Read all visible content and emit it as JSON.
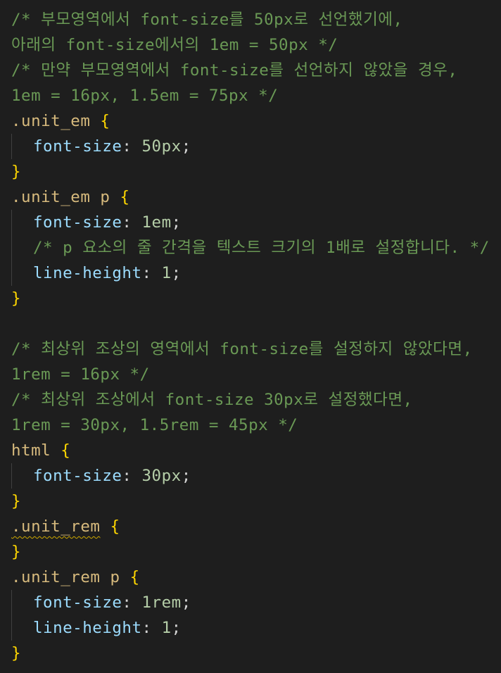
{
  "editor": {
    "lines": [
      {
        "segments": [
          {
            "t": "c",
            "v": "/* 부모영역에서 font-size를 50px로 선언했기에,"
          }
        ]
      },
      {
        "segments": [
          {
            "t": "c",
            "v": "아래의 font-size에서의 1em = 50px */"
          }
        ]
      },
      {
        "segments": [
          {
            "t": "c",
            "v": "/* 만약 부모영역에서 font-size를 선언하지 않았을 경우,"
          }
        ]
      },
      {
        "segments": [
          {
            "t": "c",
            "v": "1em = 16px, 1.5em = 75px */"
          }
        ]
      },
      {
        "segments": [
          {
            "t": "sel",
            "v": ".unit_em"
          },
          {
            "t": "plain",
            "v": " "
          },
          {
            "t": "br",
            "v": "{"
          }
        ]
      },
      {
        "indent": true,
        "segments": [
          {
            "t": "prop",
            "v": "font-size"
          },
          {
            "t": "plain",
            "v": ": "
          },
          {
            "t": "num",
            "v": "50px"
          },
          {
            "t": "plain",
            "v": ";"
          }
        ]
      },
      {
        "segments": [
          {
            "t": "br",
            "v": "}"
          }
        ]
      },
      {
        "segments": [
          {
            "t": "sel",
            "v": ".unit_em p"
          },
          {
            "t": "plain",
            "v": " "
          },
          {
            "t": "br",
            "v": "{"
          }
        ]
      },
      {
        "indent": true,
        "segments": [
          {
            "t": "prop",
            "v": "font-size"
          },
          {
            "t": "plain",
            "v": ": "
          },
          {
            "t": "num",
            "v": "1em"
          },
          {
            "t": "plain",
            "v": ";"
          }
        ]
      },
      {
        "indent": true,
        "segments": [
          {
            "t": "c",
            "v": "/* p 요소의 줄 간격을 텍스트 크기의 1배로 설정합니다. */"
          }
        ]
      },
      {
        "indent": true,
        "segments": [
          {
            "t": "prop",
            "v": "line-height"
          },
          {
            "t": "plain",
            "v": ": "
          },
          {
            "t": "num",
            "v": "1"
          },
          {
            "t": "plain",
            "v": ";"
          }
        ]
      },
      {
        "segments": [
          {
            "t": "br",
            "v": "}"
          }
        ]
      },
      {
        "segments": []
      },
      {
        "segments": [
          {
            "t": "c",
            "v": "/* 최상위 조상의 영역에서 font-size를 설정하지 않았다면,"
          }
        ]
      },
      {
        "segments": [
          {
            "t": "c",
            "v": "1rem = 16px */"
          }
        ]
      },
      {
        "segments": [
          {
            "t": "c",
            "v": "/* 최상위 조상에서 font-size 30px로 설정했다면,"
          }
        ]
      },
      {
        "segments": [
          {
            "t": "c",
            "v": "1rem = 30px, 1.5rem = 45px */"
          }
        ]
      },
      {
        "segments": [
          {
            "t": "sel",
            "v": "html"
          },
          {
            "t": "plain",
            "v": " "
          },
          {
            "t": "br",
            "v": "{"
          }
        ]
      },
      {
        "indent": true,
        "segments": [
          {
            "t": "prop",
            "v": "font-size"
          },
          {
            "t": "plain",
            "v": ": "
          },
          {
            "t": "num",
            "v": "30px"
          },
          {
            "t": "plain",
            "v": ";"
          }
        ]
      },
      {
        "segments": [
          {
            "t": "br",
            "v": "}"
          }
        ]
      },
      {
        "segments": [
          {
            "t": "sel",
            "v": ".unit_rem",
            "squiggle": true
          },
          {
            "t": "plain",
            "v": " "
          },
          {
            "t": "br",
            "v": "{"
          }
        ]
      },
      {
        "segments": [
          {
            "t": "br",
            "v": "}"
          }
        ]
      },
      {
        "segments": [
          {
            "t": "sel",
            "v": ".unit_rem p"
          },
          {
            "t": "plain",
            "v": " "
          },
          {
            "t": "br",
            "v": "{"
          }
        ]
      },
      {
        "indent": true,
        "segments": [
          {
            "t": "prop",
            "v": "font-size"
          },
          {
            "t": "plain",
            "v": ": "
          },
          {
            "t": "num",
            "v": "1rem"
          },
          {
            "t": "plain",
            "v": ";"
          }
        ]
      },
      {
        "indent": true,
        "segments": [
          {
            "t": "prop",
            "v": "line-height"
          },
          {
            "t": "plain",
            "v": ": "
          },
          {
            "t": "num",
            "v": "1"
          },
          {
            "t": "plain",
            "v": ";"
          }
        ]
      },
      {
        "segments": [
          {
            "t": "br",
            "v": "}"
          }
        ]
      }
    ]
  },
  "colors": {
    "background": "#1e1e1e",
    "comment": "#6a9955",
    "selector": "#d7ba7d",
    "bracket": "#ffd700",
    "property": "#9cdcfe",
    "number": "#b5cea8",
    "punctuation": "#d4d4d4",
    "warning_squiggle": "#cca700"
  }
}
